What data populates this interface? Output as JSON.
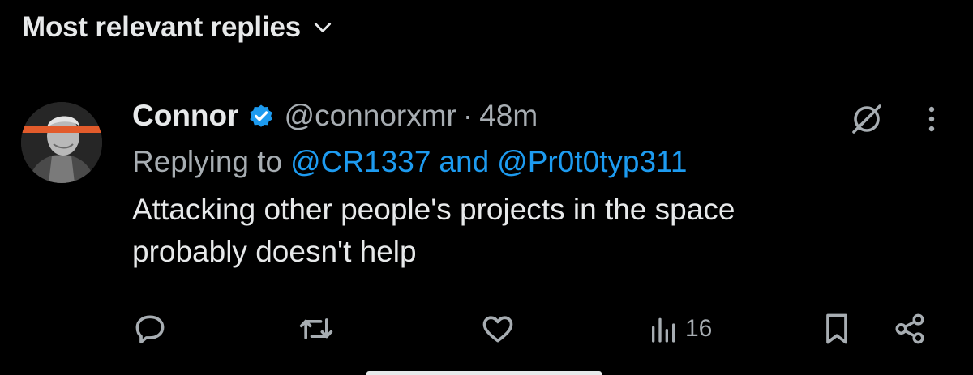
{
  "sort": {
    "label": "Most relevant replies",
    "icon": "chevron-down-icon"
  },
  "post": {
    "author": {
      "name": "Connor",
      "handle": "@connorxmr",
      "verified": true,
      "avatar_icon": "avatar-portrait"
    },
    "separator": "·",
    "timestamp": "48m",
    "replying_to": {
      "prefix": "Replying to",
      "mentions": [
        "@CR1337",
        "@Pr0t0typ311"
      ],
      "joiner": "and"
    },
    "text": "Attacking other people's projects in the space probably doesn't help",
    "actions": {
      "reply_icon": "reply-icon",
      "repost_icon": "repost-icon",
      "like_icon": "heart-icon",
      "views_icon": "views-icon",
      "views_count": "16",
      "bookmark_icon": "bookmark-icon",
      "share_icon": "share-icon"
    }
  },
  "colors": {
    "background": "#000000",
    "primary_text": "#e7e9ea",
    "secondary_text": "#a7adb2",
    "accent": "#1d9bf0"
  }
}
